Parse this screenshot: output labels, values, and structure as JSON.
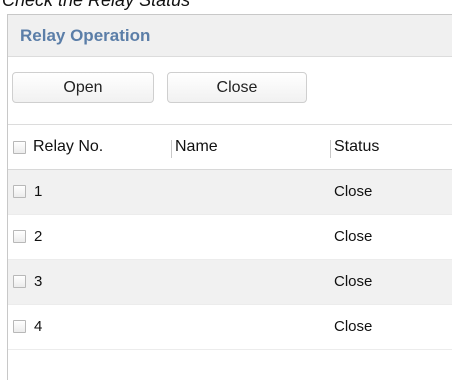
{
  "caption": "Check the Relay Status",
  "panel": {
    "title": "Relay Operation"
  },
  "toolbar": {
    "open_label": "Open",
    "close_label": "Close"
  },
  "table": {
    "columns": [
      "Relay No.",
      "Name",
      "Status"
    ],
    "rows": [
      {
        "no": "1",
        "name": "",
        "status": "Close"
      },
      {
        "no": "2",
        "name": "",
        "status": "Close"
      },
      {
        "no": "3",
        "name": "",
        "status": "Close"
      },
      {
        "no": "4",
        "name": "",
        "status": "Close"
      }
    ]
  },
  "colors": {
    "title": "#5b7ea8",
    "header_bg": "#f0f0f0",
    "alt_row_bg": "#f1f1f1"
  }
}
